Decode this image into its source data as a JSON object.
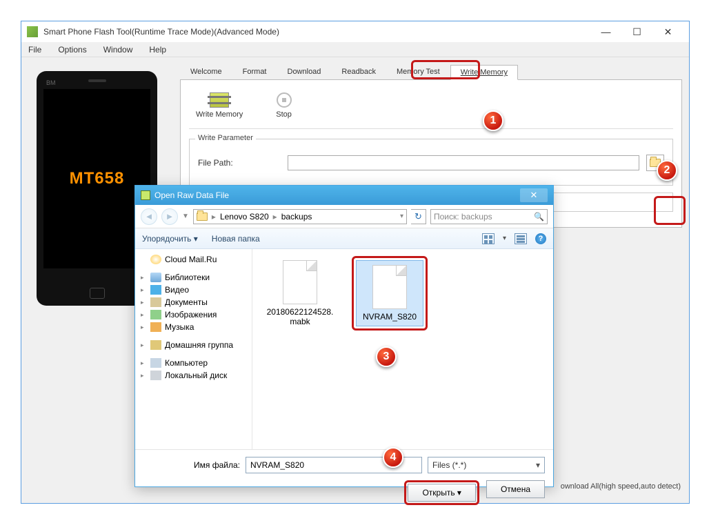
{
  "window": {
    "title": "Smart Phone Flash Tool(Runtime Trace Mode)(Advanced Mode)"
  },
  "menu": {
    "file": "File",
    "options": "Options",
    "window": "Window",
    "help": "Help"
  },
  "phone": {
    "chip": "MT658",
    "brand": "BM"
  },
  "tabs": {
    "welcome": "Welcome",
    "format": "Format",
    "download": "Download",
    "readback": "Readback",
    "memtest": "Memory Test",
    "writemem": "Write Memory"
  },
  "toolbar": {
    "writemem": "Write Memory",
    "stop": "Stop"
  },
  "group": {
    "legend": "Write Parameter",
    "filepath_label": "File Path:"
  },
  "status": "ownload All(high speed,auto detect)",
  "dialog": {
    "title": "Open Raw Data File",
    "path": {
      "seg1": "Lenovo S820",
      "seg2": "backups"
    },
    "search_placeholder": "Поиск: backups",
    "organize": "Упорядочить",
    "newfolder": "Новая папка",
    "tree": {
      "cloud": "Cloud Mail.Ru",
      "libs": "Библиотеки",
      "video": "Видео",
      "docs": "Документы",
      "images": "Изображения",
      "music": "Музыка",
      "homegroup": "Домашняя группа",
      "computer": "Компьютер",
      "disk": "Локальный диск"
    },
    "files": {
      "f1a": "20180622124528.",
      "f1b": "mabk",
      "f2": "NVRAM_S820"
    },
    "footer": {
      "fn_label": "Имя файла:",
      "fn_value": "NVRAM_S820",
      "filter": "Files (*.*)",
      "open": "Открыть",
      "cancel": "Отмена"
    }
  },
  "badges": {
    "b1": "1",
    "b2": "2",
    "b3": "3",
    "b4": "4"
  }
}
